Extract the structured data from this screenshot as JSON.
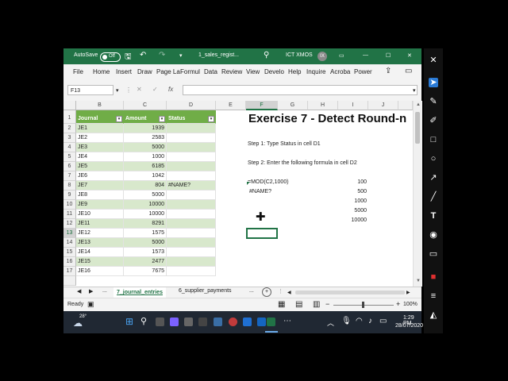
{
  "titlebar": {
    "autosave_label": "AutoSave",
    "autosave_state": "Off",
    "filename": "1_sales_regist...",
    "user_name": "ICT XMOS",
    "user_initials": "IX",
    "minimize": "—",
    "maximize": "☐",
    "close": "✕"
  },
  "menu": [
    "File",
    "Home",
    "Insert",
    "Draw",
    "Page La",
    "Formul",
    "Data",
    "Review",
    "View",
    "Develo",
    "Help",
    "Inquire",
    "Acroba",
    "Power"
  ],
  "formula_bar": {
    "name_box": "F13",
    "fx": "fx",
    "cancel": "✕",
    "enter": "✓",
    "content": ""
  },
  "columns": [
    "B",
    "C",
    "D",
    "E",
    "F",
    "G",
    "H",
    "I",
    "J"
  ],
  "rows": [
    "1",
    "2",
    "3",
    "4",
    "5",
    "6",
    "7",
    "8",
    "9",
    "10",
    "11",
    "12",
    "13",
    "14",
    "15",
    "16",
    "17"
  ],
  "table": {
    "headers": [
      "Journal",
      "Amount",
      "Status"
    ],
    "journal": [
      "JE1",
      "JE2",
      "JE3",
      "JE4",
      "JE5",
      "JE6",
      "JE7",
      "JE8",
      "JE9",
      "JE10",
      "JE11",
      "JE12",
      "JE13",
      "JE14",
      "JE15",
      "JE16"
    ],
    "amount": [
      "1939",
      "2583",
      "5000",
      "1000",
      "6185",
      "1042",
      "804",
      "5000",
      "10000",
      "10000",
      "8291",
      "1575",
      "5000",
      "1573",
      "2477",
      "7675"
    ],
    "status": [
      "",
      "",
      "",
      "",
      "",
      "",
      "#NAME?",
      "",
      "",
      "",
      "",
      "",
      "",
      "",
      "",
      ""
    ]
  },
  "exercise": {
    "title": "Exercise 7 - Detect Round-n",
    "step1": "Step 1: Type Status in cell D1",
    "step2": "Step 2: Enter the following formula in cell D2",
    "formula": "=MOD(C2,1000)",
    "error": "#NAME?",
    "i_values": [
      "100",
      "500",
      "1000",
      "5000",
      "10000"
    ]
  },
  "sheet_tabs": {
    "more_left": "...",
    "active": "7_journal_entries",
    "next": "6_supplier_payments",
    "more_right": "...",
    "add": "+"
  },
  "status": {
    "ready": "Ready",
    "zoom": "100%",
    "zoom_minus": "−",
    "zoom_plus": "+"
  },
  "taskbar": {
    "temperature": "28°",
    "time": "1:29 PM",
    "date": "28/07/2020"
  },
  "colors": {
    "excel_green": "#217346",
    "table_header": "#70ad47",
    "band": "#d8e8cc"
  },
  "icons": {
    "sidebar": [
      "close-icon",
      "pointer-icon",
      "pen-icon",
      "highlighter-icon",
      "rectangle-icon",
      "circle-icon",
      "arrow-icon",
      "line-icon",
      "text-icon",
      "color-icon",
      "note-icon",
      "record-icon",
      "menu-icon",
      "eraser-icon"
    ]
  }
}
